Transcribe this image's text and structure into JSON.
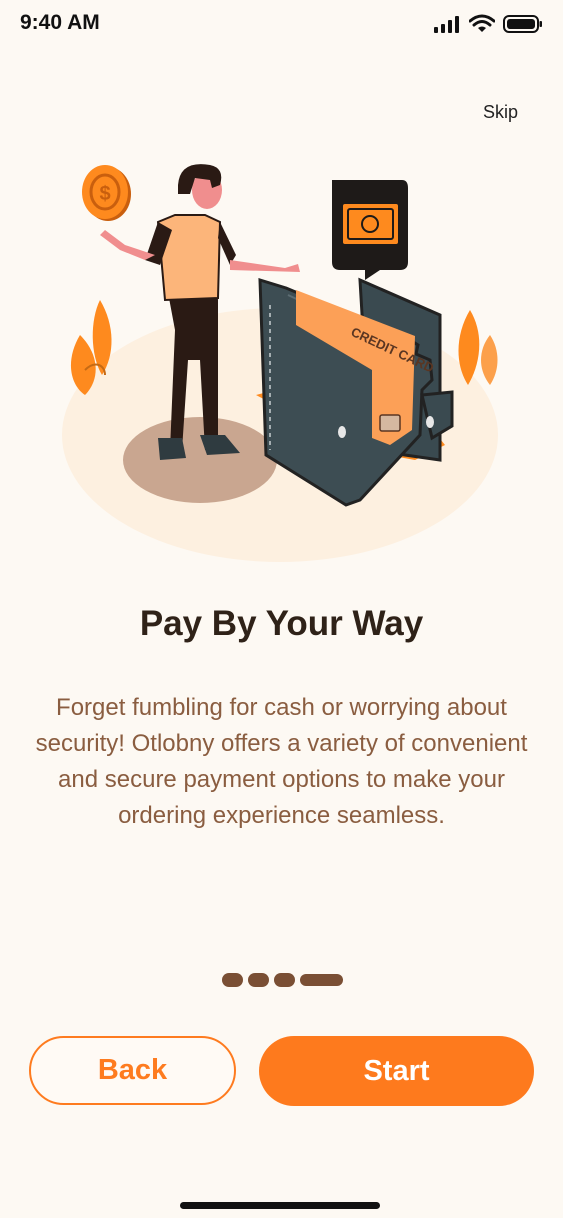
{
  "status_bar": {
    "time": "9:40 AM",
    "icons": [
      "signal-icon",
      "wifi-icon",
      "battery-icon"
    ]
  },
  "header": {
    "skip_label": "Skip"
  },
  "illustration": {
    "card_text": "CREDIT CARD",
    "coin_symbol": "$"
  },
  "content": {
    "title": "Pay By Your Way",
    "description": "Forget fumbling for cash or worrying about security! Otlobny offers a variety of convenient and secure payment options to make your ordering experience seamless."
  },
  "pagination": {
    "count": 4,
    "active_index": 3
  },
  "actions": {
    "back_label": "Back",
    "start_label": "Start"
  },
  "colors": {
    "accent": "#fe7a1d",
    "title": "#2f2218",
    "body": "#8a5d40",
    "background": "#fdf9f3"
  }
}
